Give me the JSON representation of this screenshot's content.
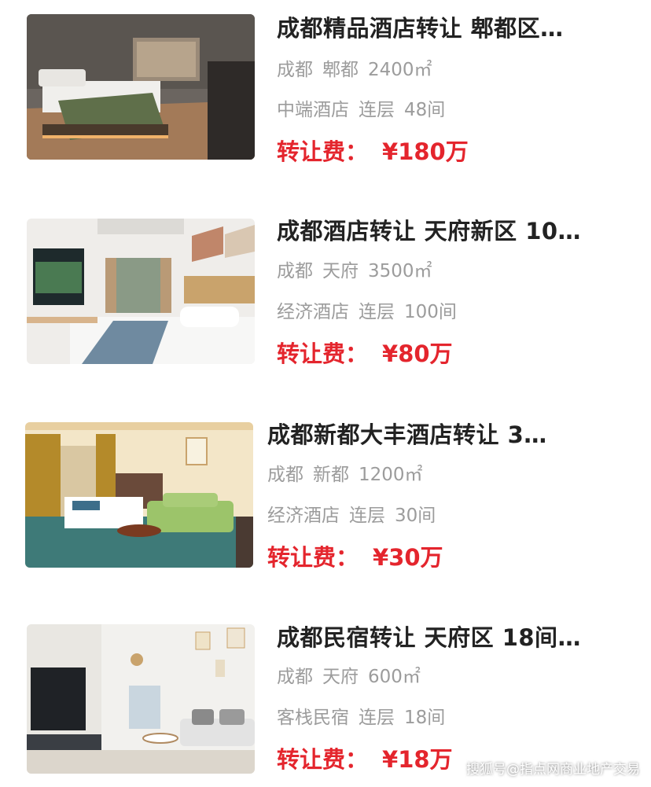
{
  "listings": [
    {
      "title": "成都精品酒店转让 郫都区…",
      "city": "成都",
      "district": "郫都",
      "area": "2400㎡",
      "type": "中端酒店",
      "floors": "连层",
      "rooms": "48间",
      "fee_label": "转让费：",
      "fee_value": "¥180万",
      "thumbnail_icon": "hotel-room-photo"
    },
    {
      "title": "成都酒店转让 天府新区 10…",
      "city": "成都",
      "district": "天府",
      "area": "3500㎡",
      "type": "经济酒店",
      "floors": "连层",
      "rooms": "100间",
      "fee_label": "转让费：",
      "fee_value": "¥80万",
      "thumbnail_icon": "hotel-room-photo"
    },
    {
      "title": "成都新都大丰酒店转让 3…",
      "city": "成都",
      "district": "新都",
      "area": "1200㎡",
      "type": "经济酒店",
      "floors": "连层",
      "rooms": "30间",
      "fee_label": "转让费：",
      "fee_value": "¥30万",
      "thumbnail_icon": "hotel-room-photo"
    },
    {
      "title": "成都民宿转让 天府区 18间…",
      "city": "成都",
      "district": "天府",
      "area": "600㎡",
      "type": "客栈民宿",
      "floors": "连层",
      "rooms": "18间",
      "fee_label": "转让费：",
      "fee_value": "¥18万",
      "thumbnail_icon": "apartment-living-room-photo"
    }
  ],
  "watermark": "搜狐号@指点网商业地产交易",
  "colors": {
    "price": "#e4252d",
    "title": "#222222",
    "meta": "#9c9c9c"
  }
}
